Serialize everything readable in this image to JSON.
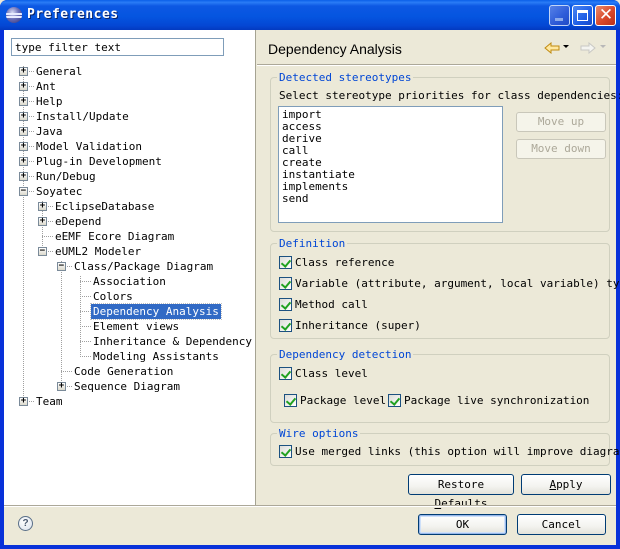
{
  "window": {
    "title": "Preferences",
    "app_icon": "eclipse-icon",
    "controls": [
      "minimize",
      "maximize",
      "close"
    ]
  },
  "left": {
    "filter_placeholder": "type filter text",
    "filter_value": "type filter text",
    "tree": [
      {
        "label": "General",
        "level": 0,
        "expander": "+"
      },
      {
        "label": "Ant",
        "level": 0,
        "expander": "+"
      },
      {
        "label": "Help",
        "level": 0,
        "expander": "+"
      },
      {
        "label": "Install/Update",
        "level": 0,
        "expander": "+"
      },
      {
        "label": "Java",
        "level": 0,
        "expander": "+"
      },
      {
        "label": "Model Validation",
        "level": 0,
        "expander": "+"
      },
      {
        "label": "Plug-in Development",
        "level": 0,
        "expander": "+"
      },
      {
        "label": "Run/Debug",
        "level": 0,
        "expander": "+"
      },
      {
        "label": "Soyatec",
        "level": 0,
        "expander": "-"
      },
      {
        "label": "EclipseDatabase",
        "level": 1,
        "expander": "+"
      },
      {
        "label": "eDepend",
        "level": 1,
        "expander": "+"
      },
      {
        "label": "eEMF Ecore Diagram",
        "level": 1,
        "expander": ""
      },
      {
        "label": "eUML2 Modeler",
        "level": 1,
        "expander": "-"
      },
      {
        "label": "Class/Package Diagram",
        "level": 2,
        "expander": "-"
      },
      {
        "label": "Association",
        "level": 3,
        "expander": ""
      },
      {
        "label": "Colors",
        "level": 3,
        "expander": ""
      },
      {
        "label": "Dependency Analysis",
        "level": 3,
        "expander": "",
        "selected": true
      },
      {
        "label": "Element views",
        "level": 3,
        "expander": ""
      },
      {
        "label": "Inheritance & Dependency",
        "level": 3,
        "expander": ""
      },
      {
        "label": "Modeling Assistants",
        "level": 3,
        "expander": ""
      },
      {
        "label": "Code Generation",
        "level": 2,
        "expander": ""
      },
      {
        "label": "Sequence Diagram",
        "level": 2,
        "expander": "+"
      },
      {
        "label": "Team",
        "level": 0,
        "expander": "+"
      }
    ]
  },
  "page": {
    "title": "Dependency Analysis",
    "nav": {
      "back_icon": "back-arrow-icon",
      "forward_icon": "forward-arrow-icon",
      "forward_enabled": false
    }
  },
  "stereotypes": {
    "legend": "Detected stereotypes",
    "instruction": "Select stereotype priorities for class dependencies:",
    "items": [
      "import",
      "access",
      "derive",
      "call",
      "create",
      "instantiate",
      "implements",
      "send"
    ],
    "move_up": "Move up",
    "move_down": "Move down"
  },
  "definition": {
    "legend": "Definition",
    "options": [
      {
        "label": "Class reference",
        "checked": true
      },
      {
        "label": "Variable (attribute, argument, local variable) type",
        "checked": true
      },
      {
        "label": "Method call",
        "checked": true
      },
      {
        "label": "Inheritance (super)",
        "checked": true
      }
    ]
  },
  "detection": {
    "legend": "Dependency detection",
    "class_level": {
      "label": "Class level",
      "checked": true
    },
    "package_level": {
      "label": "Package level",
      "checked": true
    },
    "package_sync": {
      "label": "Package live synchronization",
      "checked": true
    }
  },
  "wire": {
    "legend": "Wire options",
    "merged_links": {
      "label": "Use merged links (this option will improve diagram re",
      "checked": true
    }
  },
  "buttons": {
    "restore_defaults_pre": "Restore ",
    "restore_defaults_mn": "D",
    "restore_defaults_post": "efaults",
    "apply_mn": "A",
    "apply_post": "pply",
    "ok": "OK",
    "cancel": "Cancel"
  },
  "colors": {
    "selection": "#316ac5",
    "legend_text": "#0046d5",
    "dialog_bg": "#ece9d8",
    "title_bar": "#0555e0"
  }
}
